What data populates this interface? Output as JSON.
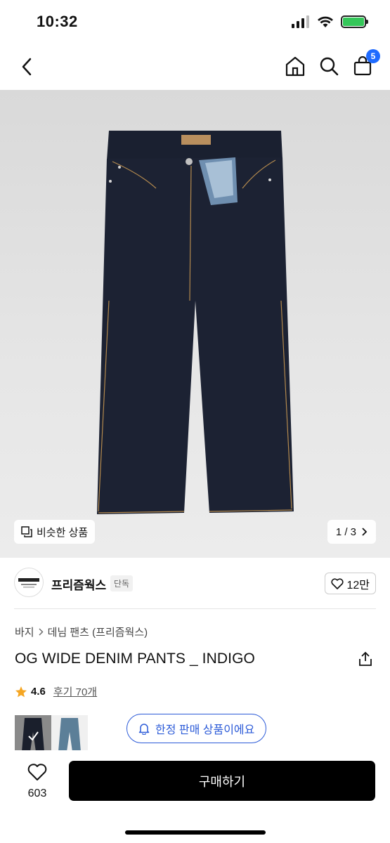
{
  "status_bar": {
    "time": "10:32"
  },
  "nav": {
    "cart_badge": "5"
  },
  "hero": {
    "similar_label": "비슷한 상품",
    "page_indicator": "1 / 3"
  },
  "seller": {
    "name": "프리즘웍스",
    "tag": "단독",
    "likes": "12만"
  },
  "product": {
    "breadcrumb": [
      "바지",
      "데님 팬츠 (프리즘웍스)"
    ],
    "title": "OG WIDE DENIM PANTS _ INDIGO",
    "rating": "4.6",
    "reviews": "후기 70개",
    "limited_label": "한정 판매 상품이에요"
  },
  "bottom": {
    "wish_count": "603",
    "buy_label": "구매하기"
  },
  "colors": {
    "accent_blue": "#2c5bd8",
    "badge_blue": "#1f6bff",
    "star": "#f5a623",
    "denim": "#1c2233"
  }
}
